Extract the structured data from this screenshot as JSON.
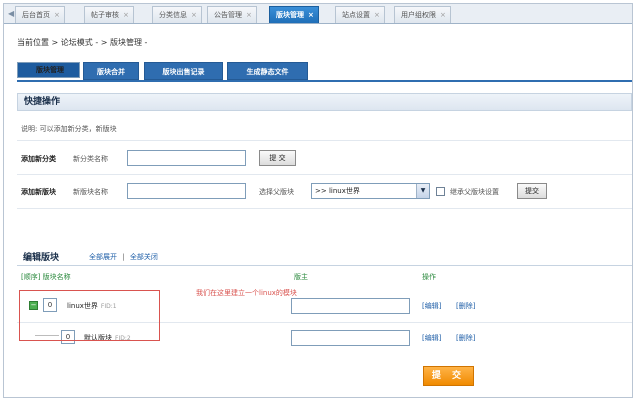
{
  "tabs": [
    {
      "label": "后台首页"
    },
    {
      "label": "帖子审核"
    },
    {
      "label": "分类信息"
    },
    {
      "label": "公告管理"
    },
    {
      "label": "版块管理",
      "active": true
    },
    {
      "label": "站点设置"
    },
    {
      "label": "用户组权限"
    }
  ],
  "tab_close": "×",
  "breadcrumb": "当前位置 > 论坛模式 - > 版块管理 -",
  "function_tabs": [
    "版块管理",
    "版块合并",
    "版块出售记录",
    "生成静态文件"
  ],
  "quick_ops": {
    "title": "快捷操作",
    "note": "说明: 可以添加新分类，新版块",
    "add_category": {
      "label": "添加新分类",
      "field_label": "新分类名称",
      "value": "",
      "submit": "提 交"
    },
    "add_forum": {
      "label": "添加新版块",
      "field_label": "新版块名称",
      "value": "",
      "parent_label": "选择父版块",
      "parent_selected": ">> linux世界",
      "inherit_label": "继承父版块设置",
      "submit": "提交"
    }
  },
  "edit": {
    "title": "编辑版块",
    "expand_all": "全部展开",
    "separator": "|",
    "collapse_all": "全部关闭",
    "col_order_name": "[顺序] 版块名称",
    "col_moderator": "版主",
    "col_action": "操作",
    "rows": [
      {
        "order": "0",
        "name": "linux世界",
        "fid": "FID:1",
        "moderator": "",
        "edit": "[编辑]",
        "delete": "[删除]"
      },
      {
        "order": "0",
        "name": "默认版块",
        "fid": "FID:2",
        "moderator": "",
        "edit": "[编辑]",
        "delete": "[删除]"
      }
    ],
    "annotation": "我们在这里建立一个linux的模块",
    "submit": "提 交"
  }
}
